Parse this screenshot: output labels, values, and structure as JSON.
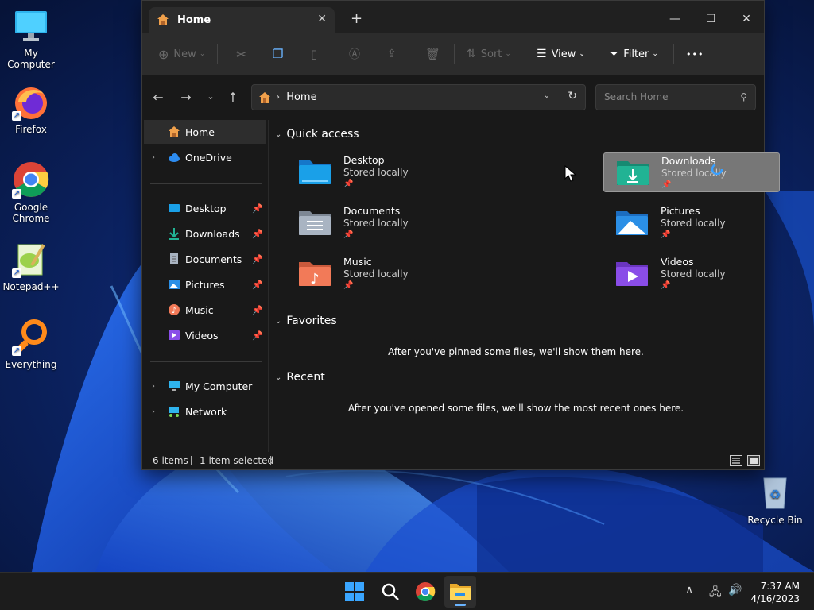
{
  "desktop": {
    "icons": [
      {
        "label": "My Computer"
      },
      {
        "label": "Firefox"
      },
      {
        "label": "Google Chrome"
      },
      {
        "label": "Notepad++"
      },
      {
        "label": "Everything"
      },
      {
        "label": "Recycle Bin"
      }
    ]
  },
  "window": {
    "tab_title": "Home",
    "tab_close": "✕",
    "new_tab": "+",
    "controls": {
      "minimize": "—",
      "maximize": "☐",
      "close": "✕"
    }
  },
  "commandbar": {
    "new_label": "New",
    "sort_label": "Sort",
    "view_label": "View",
    "filter_label": "Filter",
    "more_label": "•••"
  },
  "address": {
    "path": "Home",
    "search_placeholder": "Search Home"
  },
  "sidebar": {
    "home": "Home",
    "onedrive": "OneDrive",
    "pinned": [
      {
        "label": "Desktop"
      },
      {
        "label": "Downloads"
      },
      {
        "label": "Documents"
      },
      {
        "label": "Pictures"
      },
      {
        "label": "Music"
      },
      {
        "label": "Videos"
      }
    ],
    "my_computer": "My Computer",
    "network": "Network"
  },
  "content": {
    "quick_access_title": "Quick access",
    "tiles": [
      {
        "name": "Desktop",
        "status": "Stored locally",
        "color": "#1aa0e8"
      },
      {
        "name": "Downloads",
        "status": "Stored locally",
        "color": "#21b394"
      },
      {
        "name": "Documents",
        "status": "Stored locally",
        "color": "#a9b4c2"
      },
      {
        "name": "Pictures",
        "status": "Stored locally",
        "color": "#2b8fe6"
      },
      {
        "name": "Music",
        "status": "Stored locally",
        "color": "#f27a58"
      },
      {
        "name": "Videos",
        "status": "Stored locally",
        "color": "#8a4de8"
      }
    ],
    "favorites_title": "Favorites",
    "favorites_empty": "After you've pinned some files, we'll show them here.",
    "recent_title": "Recent",
    "recent_empty": "After you've opened some files, we'll show the most recent ones here."
  },
  "statusbar": {
    "item_count": "6 items",
    "selection": "1 item selected"
  },
  "taskbar": {
    "time": "7:37 AM",
    "date": "4/16/2023"
  }
}
